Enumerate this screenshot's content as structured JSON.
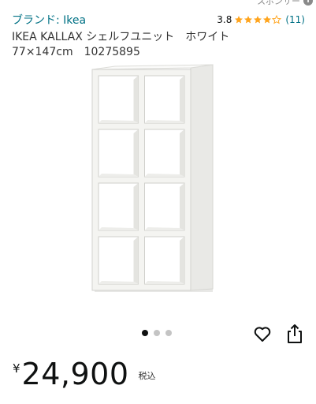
{
  "sponsor": {
    "label": "スポンサー"
  },
  "brand": {
    "label": "ブランド: Ikea"
  },
  "rating": {
    "value": "3.8",
    "stars": 4,
    "max_stars": 5,
    "count": "(11)"
  },
  "product": {
    "title_line1": "IKEA KALLAX シェルフユニット　ホワイト",
    "title_line2": "77×147cm　10275895"
  },
  "gallery": {
    "image_count": 3,
    "active_index": 0
  },
  "actions": {
    "wishlist_icon": "heart-outline-icon",
    "share_icon": "share-icon"
  },
  "price": {
    "currency": "¥",
    "amount": "24,900",
    "tax_note": "税込"
  },
  "colors": {
    "link": "#007185",
    "star": "#ffa41c",
    "shelf": "#f4f4f1"
  }
}
